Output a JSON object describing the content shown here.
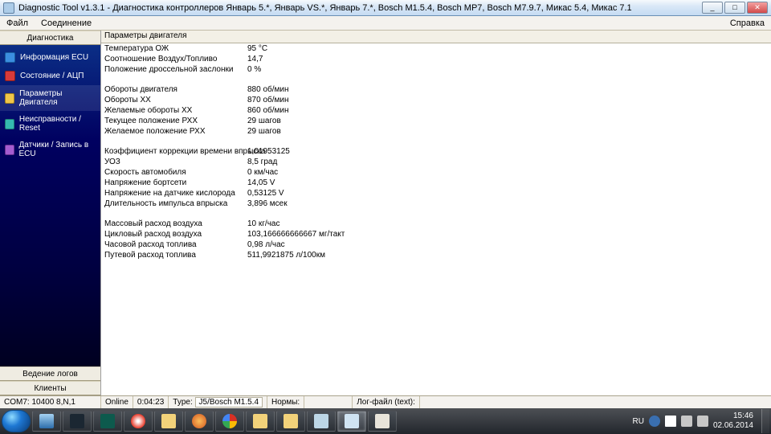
{
  "titlebar": {
    "title": "Diagnostic Tool v1.3.1 - Диагностика контроллеров Январь 5.*, Январь VS.*, Январь 7.*, Bosch M1.5.4, Bosch MP7, Bosch M7.9.7, Микас 5.4, Микас 7.1"
  },
  "menu": {
    "file": "Файл",
    "connection": "Соединение",
    "help": "Справка"
  },
  "sidebar": {
    "top": "Диагностика",
    "items": [
      {
        "label": "Информация ECU",
        "icon": "ic-blue"
      },
      {
        "label": "Состояние / АЦП",
        "icon": "ic-red"
      },
      {
        "label": "Параметры Двигателя",
        "icon": "ic-yellow"
      },
      {
        "label": "Неисправности / Reset",
        "icon": "ic-teal"
      },
      {
        "label": "Датчики / Запись в ECU",
        "icon": "ic-purple"
      }
    ],
    "logs": "Ведение логов",
    "clients": "Клиенты"
  },
  "content": {
    "header": "Параметры двигателя",
    "groups": [
      [
        {
          "label": "Температура ОЖ",
          "value": "95 °C"
        },
        {
          "label": "Соотношение Воздух/Топливо",
          "value": "14,7"
        },
        {
          "label": "Положение дроссельной заслонки",
          "value": "0 %"
        }
      ],
      [
        {
          "label": "Обороты двигателя",
          "value": "880 об/мин"
        },
        {
          "label": "Обороты ХХ",
          "value": "870 об/мин"
        },
        {
          "label": "Желаемые обороты ХХ",
          "value": "860 об/мин"
        },
        {
          "label": "Текущее положение РХХ",
          "value": "29 шагов"
        },
        {
          "label": "Желаемое положение РХХ",
          "value": "29 шагов"
        }
      ],
      [
        {
          "label": "Коэффициент коррекции времени впрыска",
          "value": "1,01953125"
        },
        {
          "label": "УОЗ",
          "value": "8,5 град"
        },
        {
          "label": "Скорость автомобиля",
          "value": "0 км/час"
        },
        {
          "label": "Напряжение бортсети",
          "value": "14,05 V"
        },
        {
          "label": "Напряжение на датчике кислорода",
          "value": "0,53125 V"
        },
        {
          "label": "Длительность импульса впрыска",
          "value": "3,896 мсек"
        }
      ],
      [
        {
          "label": "Массовый расход воздуха",
          "value": "10 кг/час"
        },
        {
          "label": "Цикловый расход воздуха",
          "value": "103,166666666667 мг/такт"
        },
        {
          "label": "Часовой расход топлива",
          "value": "0,98 л/час"
        },
        {
          "label": "Путевой расход топлива",
          "value": "511,9921875 л/100км"
        }
      ]
    ]
  },
  "status": {
    "port": "COM7: 10400 8,N,1",
    "online": "Online",
    "timer": "0:04:23",
    "type_label": "Type:",
    "type_value": "J5/Bosch M1.5.4",
    "norms": "Нормы:",
    "log": "Лог-файл (text):"
  },
  "tray": {
    "lang": "RU",
    "time": "15:46",
    "date": "02.06.2014"
  }
}
